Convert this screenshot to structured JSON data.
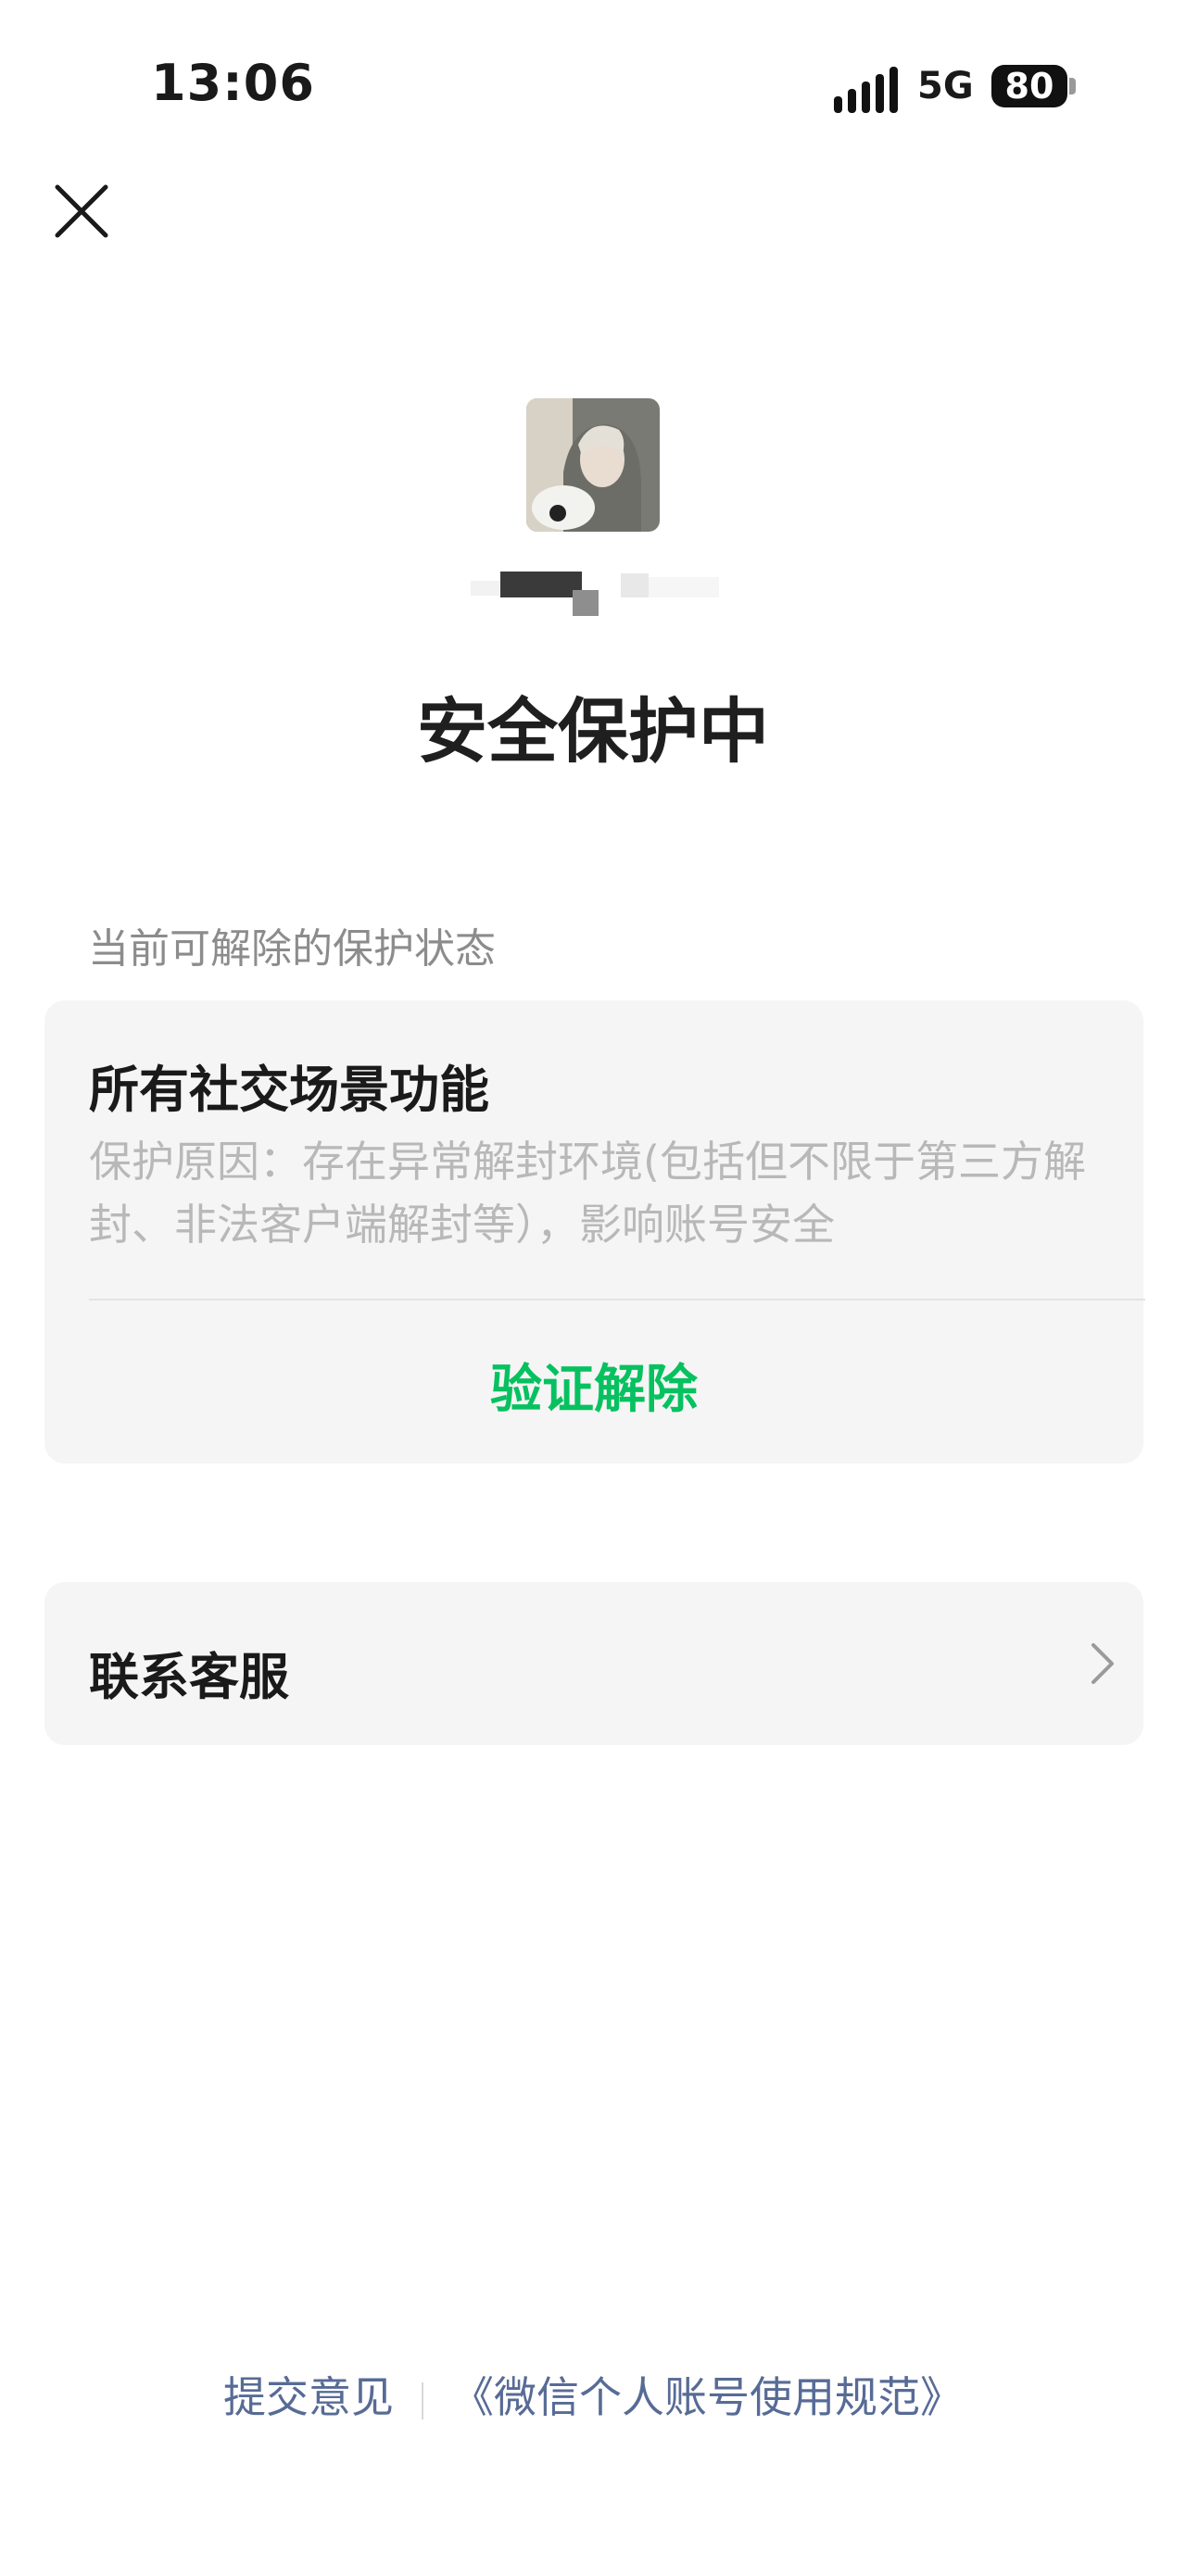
{
  "status_bar": {
    "time": "13:06",
    "network": "5G",
    "battery": "80"
  },
  "avatar": {
    "icon": "user-photo"
  },
  "page": {
    "title": "安全保护中",
    "section_label": "当前可解除的保护状态"
  },
  "protection_card": {
    "title": "所有社交场景功能",
    "reason": "保护原因：存在异常解封环境(包括但不限于第三方解封、非法客户端解封等），影响账号安全",
    "action": "验证解除"
  },
  "contact_card": {
    "label": "联系客服"
  },
  "footer": {
    "feedback": "提交意见",
    "terms": "《微信个人账号使用规范》"
  },
  "colors": {
    "accent_green": "#07c160",
    "link_blue": "#576b95",
    "card_bg": "#f5f5f5"
  }
}
